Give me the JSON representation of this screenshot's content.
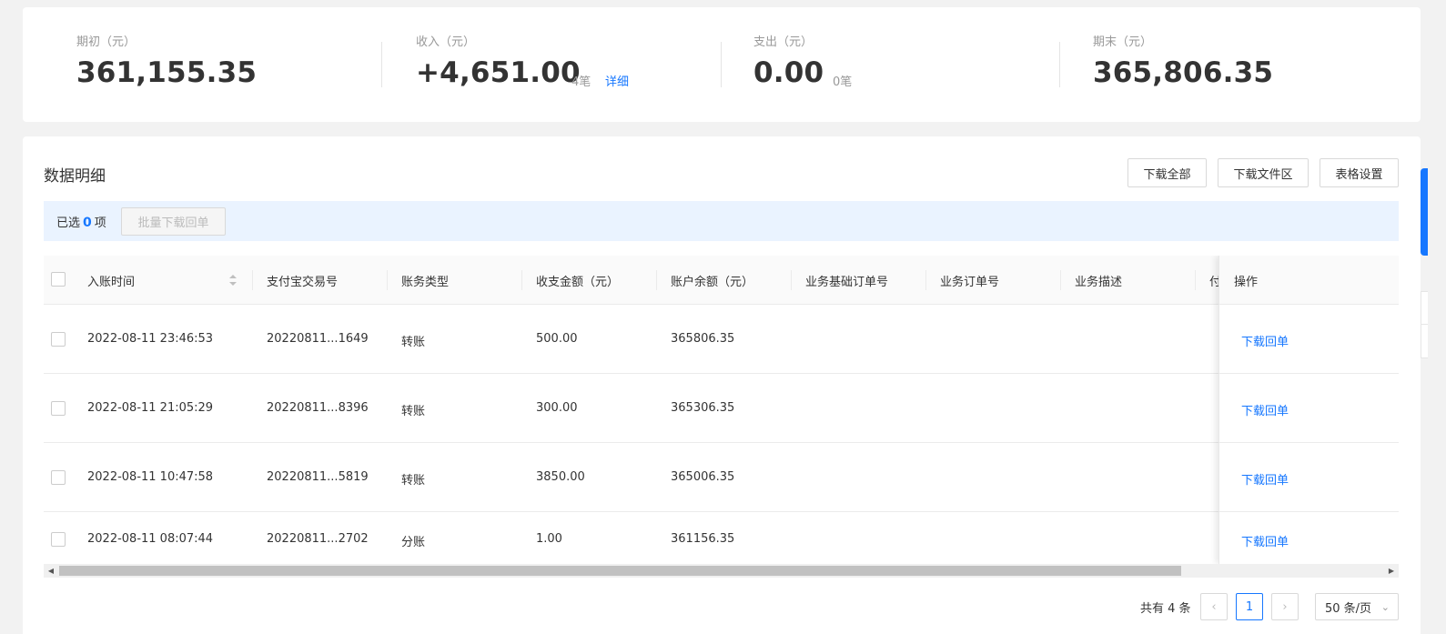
{
  "summary": {
    "opening": {
      "label": "期初（元）",
      "value": "361,155.35"
    },
    "income": {
      "label": "收入（元）",
      "value": "+4,651.00",
      "count": "4笔",
      "detail_link": "详细"
    },
    "expense": {
      "label": "支出（元）",
      "value": "0.00",
      "count": "0笔"
    },
    "closing": {
      "label": "期末（元）",
      "value": "365,806.35"
    }
  },
  "detail": {
    "title": "数据明细",
    "buttons": {
      "download_all": "下载全部",
      "download_files": "下载文件区",
      "table_settings": "表格设置"
    },
    "selection": {
      "prefix": "已选",
      "count": "0",
      "suffix": "项",
      "batch_button": "批量下载回单"
    }
  },
  "table": {
    "headers": [
      "入账时间",
      "支付宝交易号",
      "账务类型",
      "收支金额（元）",
      "账户余额（元）",
      "业务基础订单号",
      "业务订单号",
      "业务描述",
      "付",
      "操作"
    ],
    "rows": [
      {
        "time": "2022-08-11 23:46:53",
        "trade_no": "20220811...1649",
        "type": "转账",
        "amount": "500.00",
        "balance": "365806.35",
        "action": "下载回单"
      },
      {
        "time": "2022-08-11 21:05:29",
        "trade_no": "20220811...8396",
        "type": "转账",
        "amount": "300.00",
        "balance": "365306.35",
        "action": "下载回单"
      },
      {
        "time": "2022-08-11 10:47:58",
        "trade_no": "20220811...5819",
        "type": "转账",
        "amount": "3850.00",
        "balance": "365006.35",
        "action": "下载回单"
      },
      {
        "time": "2022-08-11 08:07:44",
        "trade_no": "20220811...2702",
        "type": "分账",
        "amount": "1.00",
        "balance": "361156.35",
        "action": "下载回单"
      }
    ]
  },
  "pagination": {
    "total": "共有 4 条",
    "current_page": "1",
    "prev_icon": "‹",
    "next_icon": "›",
    "page_size": "50 条/页",
    "page_size_icon": "⌄"
  },
  "scrollbar": {
    "left_arrow": "◀",
    "right_arrow": "▶"
  },
  "colors": {
    "accent": "#1677ff",
    "selection_bar": "#eaf3ff"
  }
}
